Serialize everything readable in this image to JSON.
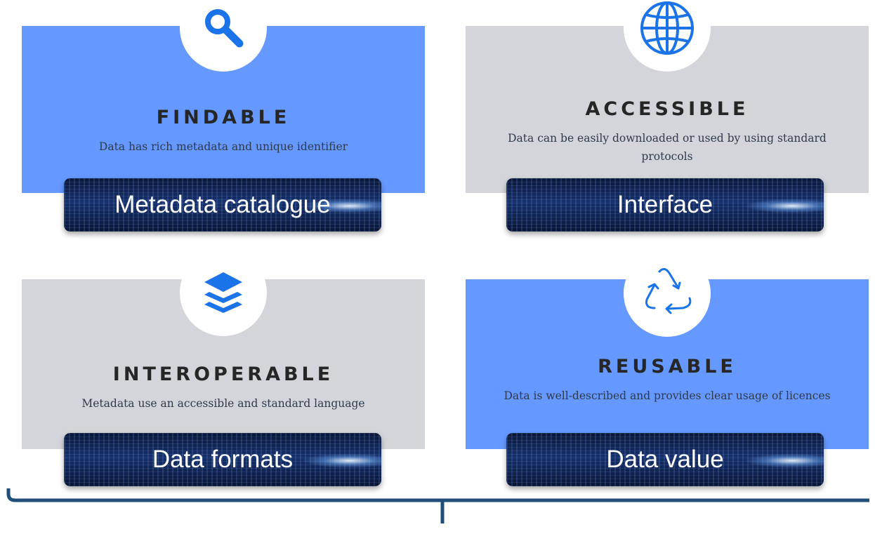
{
  "colors": {
    "blue_panel": "#6699ff",
    "gray_panel": "#d3d5da",
    "icon_blue": "#1a73e8",
    "bracket": "#1f4e79"
  },
  "principles": {
    "findable": {
      "icon": "search-icon",
      "title": "FINDABLE",
      "description": "Data has rich metadata and unique identifier",
      "banner": "Metadata catalogue"
    },
    "accessible": {
      "icon": "globe-icon",
      "title": "ACCESSIBLE",
      "description": "Data can be easily downloaded or used by using standard protocols",
      "banner": "Interface"
    },
    "interoperable": {
      "icon": "layers-icon",
      "title": "INTEROPERABLE",
      "description": "Metadata use an accessible and standard language",
      "banner": "Data formats"
    },
    "reusable": {
      "icon": "recycle-icon",
      "title": "REUSABLE",
      "description": "Data is well-described and provides clear usage of licences",
      "banner": "Data value"
    }
  }
}
